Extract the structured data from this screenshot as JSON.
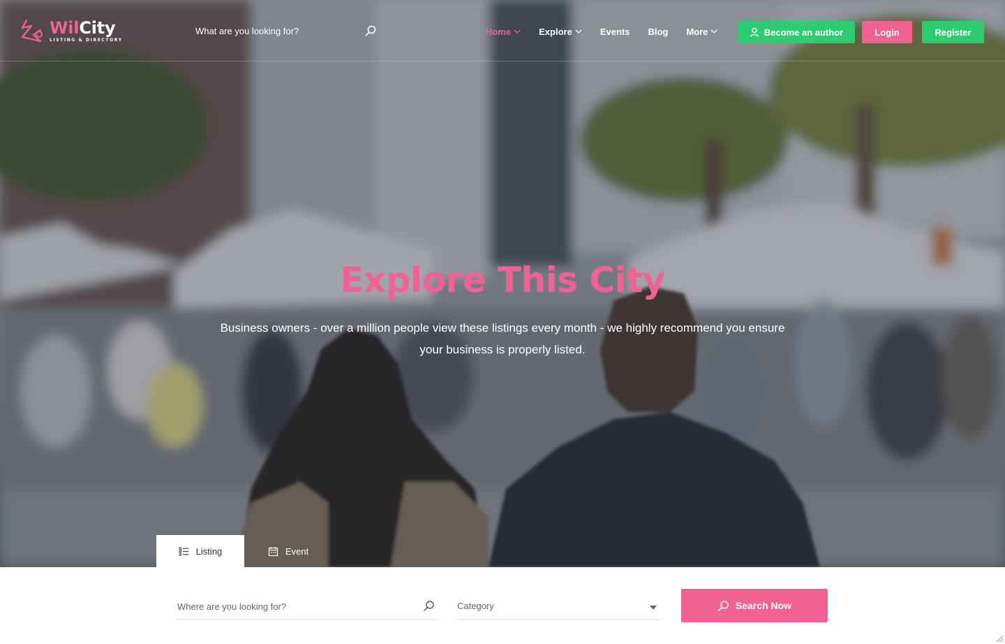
{
  "brand": {
    "name_part1": "Wil",
    "name_part2": "City",
    "tagline": "LISTING & DIRECTORY",
    "accent_color": "#f06292",
    "green_color": "#2ecc71"
  },
  "header": {
    "search": {
      "placeholder": "What are you looking for?",
      "icon": "search-icon"
    },
    "nav": [
      {
        "label": "Home",
        "active": true,
        "has_dropdown": true
      },
      {
        "label": "Explore",
        "active": false,
        "has_dropdown": true
      },
      {
        "label": "Events",
        "active": false,
        "has_dropdown": false
      },
      {
        "label": "Blog",
        "active": false,
        "has_dropdown": false
      },
      {
        "label": "More",
        "active": false,
        "has_dropdown": true
      }
    ],
    "buttons": {
      "author": "Become an author",
      "author_icon": "user-icon",
      "login": "Login",
      "register": "Register"
    }
  },
  "hero": {
    "title": "Explore This City",
    "subtitle_line1": "Business owners - over a million people view these listings every month - we highly recommend you ensure",
    "subtitle_line2": "your business is properly listed."
  },
  "search_tabs": [
    {
      "label": "Listing",
      "icon": "list-icon",
      "active": true
    },
    {
      "label": "Event",
      "icon": "calendar-icon",
      "active": false
    }
  ],
  "search_form": {
    "where_placeholder": "Where are you looking for?",
    "category_label": "Category",
    "submit_label": "Search Now"
  }
}
